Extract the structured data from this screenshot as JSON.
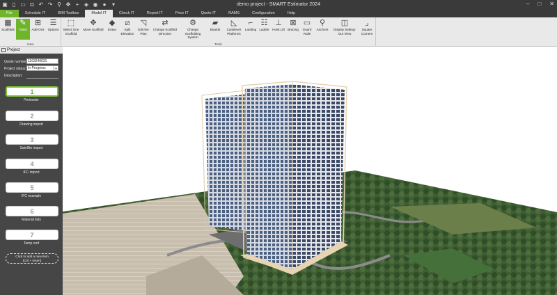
{
  "window": {
    "title": "demo project - SMART Estimator 2024"
  },
  "quick_access": [
    "app-logo-icon",
    "new-file-icon",
    "open-folder-icon",
    "save-icon",
    "undo-icon",
    "redo-icon",
    "zoom-icon",
    "pan-icon",
    "add-icon",
    "view-cube-icon",
    "render-icon",
    "sphere-icon",
    "dropdown-icon"
  ],
  "window_controls": {
    "minimize": "–",
    "maximize": "□",
    "close": "✕"
  },
  "menu": {
    "tabs": [
      {
        "label": "File"
      },
      {
        "label": "Schedule IT"
      },
      {
        "label": "BIM Toolbox"
      },
      {
        "label": "Model IT"
      },
      {
        "label": "Check IT"
      },
      {
        "label": "Report IT"
      },
      {
        "label": "Price IT"
      },
      {
        "label": "Quote IT"
      },
      {
        "label": "RAMS"
      },
      {
        "label": "Configuration"
      },
      {
        "label": "Help"
      }
    ]
  },
  "ribbon": {
    "view_group_label": "View",
    "tools_group_label": "Tools",
    "view_buttons": [
      {
        "label": "Scaffolds",
        "icon": "scaffold-icon"
      },
      {
        "label": "Tasks",
        "icon": "wrench-icon"
      },
      {
        "label": "Add-Ons",
        "icon": "add-ons-icon"
      },
      {
        "label": "Options",
        "icon": "options-icon"
      }
    ],
    "tool_buttons": [
      {
        "label": "Select One Scaffold",
        "icon": "select-icon"
      },
      {
        "label": "Move Scaffold",
        "icon": "move-icon"
      },
      {
        "label": "Erase",
        "icon": "eraser-icon"
      },
      {
        "label": "Split Elevation",
        "icon": "split-icon"
      },
      {
        "label": "Edit the Plan",
        "icon": "edit-plan-icon"
      },
      {
        "label": "Change Scaffold Direction",
        "icon": "direction-icon"
      },
      {
        "label": "Change Scaffolding System",
        "icon": "system-icon"
      },
      {
        "label": "Boards",
        "icon": "boards-icon"
      },
      {
        "label": "Cantilever Platforms",
        "icon": "cantilever-icon"
      },
      {
        "label": "Landing",
        "icon": "landing-icon"
      },
      {
        "label": "Ladder",
        "icon": "ladder-icon"
      },
      {
        "label": "Hoist Lift",
        "icon": "hoist-icon"
      },
      {
        "label": "Bracing",
        "icon": "bracing-icon"
      },
      {
        "label": "Guard Rails",
        "icon": "guard-rails-icon"
      },
      {
        "label": "Anchors",
        "icon": "anchor-icon"
      },
      {
        "label": "Display Setting-Out View",
        "icon": "display-icon"
      },
      {
        "label": "Square Corners",
        "icon": "corner-icon"
      }
    ]
  },
  "project_panel": {
    "title": "Project",
    "quote_number_label": "Quote number:",
    "quote_number_value": "1163240031",
    "status_label": "Project status:",
    "status_value": "In Progress",
    "description_label": "Description:",
    "steps": [
      {
        "number": "1",
        "label": "Perimeter"
      },
      {
        "number": "2",
        "label": "Drawing import"
      },
      {
        "number": "3",
        "label": "Satellite import"
      },
      {
        "number": "4",
        "label": "IFC import"
      },
      {
        "number": "5",
        "label": "IFC example"
      },
      {
        "number": "6",
        "label": "Material lists"
      },
      {
        "number": "7",
        "label": "Temp roof"
      }
    ],
    "add_new": {
      "line1": "Click to add a new item",
      "line2": "[Ctrl + Insert]"
    }
  },
  "colors": {
    "accent": "#6fb52c",
    "menubar": "#3a3a3a",
    "ribbon": "#e9e9e9",
    "panel": "#464646"
  }
}
